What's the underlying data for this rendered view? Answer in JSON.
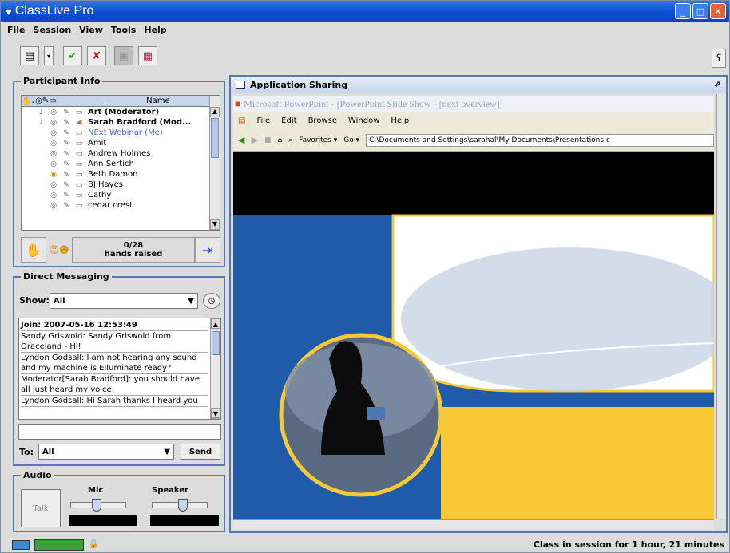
{
  "window": {
    "title": "ClassLive Pro",
    "minimize": "_",
    "maximize": "□",
    "close": "✕"
  },
  "menu": [
    "File",
    "Session",
    "View",
    "Tools",
    "Help"
  ],
  "participant_info": {
    "label": "Participant Info",
    "name_header": "Name",
    "participants": [
      "Art (Moderator)",
      "Sarah Bradford (Mod...",
      "NExt Webinar (Me)",
      "Amit",
      "Andrew Holmes",
      "Ann Sertich",
      "Beth Damon",
      "BJ Hayes",
      "Cathy",
      "cedar crest"
    ],
    "hands_count": "0/28",
    "hands_label": "hands raised"
  },
  "direct_messaging": {
    "label": "Direct Messaging",
    "show_label": "Show:",
    "show_value": "All",
    "messages": [
      "Join: 2007-05-16 12:53:49",
      "Sandy Griswold: Sandy Griswold from Oraceland - Hi!",
      "Lyndon Godsall: I am not hearing any sound and my machine is Elluminate ready?",
      "Moderator[Sarah Bradford]: you should have all just heard my voice",
      "Lyndon Godsall: Hi Sarah thanks I heard you"
    ],
    "to_label": "To:",
    "to_value": "All",
    "send_label": "Send"
  },
  "audio": {
    "label": "Audio",
    "talk_label": "Talk",
    "mic_label": "Mic",
    "speaker_label": "Speaker",
    "mic_level": 0.45,
    "speaker_level": 0.55
  },
  "app_sharing": {
    "title": "Application Sharing",
    "ppt_title": "Microsoft PowerPoint - [PowerPoint Slide Show - [next overview]]",
    "ppt_menu": [
      "File",
      "Edit",
      "Browse",
      "Window",
      "Help"
    ],
    "favorites": "Favorites ▾",
    "go": "Go ▾",
    "address": "C:\\Documents and Settings\\sarahal\\My Documents\\Presentations c"
  },
  "status": {
    "text": "Class in session for 1 hour, 21 minutes"
  },
  "colors": {
    "title_blue": "#0c4fd1",
    "panel_border": "#5678b0",
    "slide_blue": "#1f5ba8",
    "slide_yellow": "#f7c937"
  }
}
